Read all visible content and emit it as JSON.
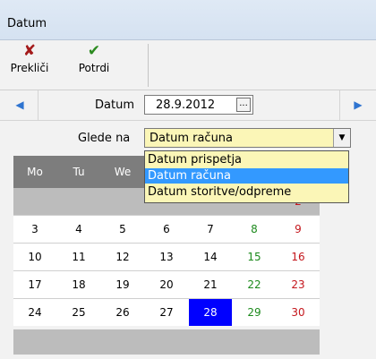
{
  "window": {
    "title": "Datum"
  },
  "toolbar": {
    "cancel_label": "Prekliči",
    "confirm_label": "Potrdi"
  },
  "date_row": {
    "label": "Datum",
    "value": "28.9.2012",
    "ellipsis": "..."
  },
  "glede": {
    "label": "Glede na",
    "selected": "Datum računa",
    "options": [
      "Datum prispetja",
      "Datum računa",
      "Datum storitve/odpreme"
    ],
    "highlighted_option": "Datum računa"
  },
  "calendar": {
    "days_of_week": [
      "Mo",
      "Tu",
      "We",
      "Th",
      "Fr",
      "Sa",
      "Su"
    ],
    "weeks": [
      [
        null,
        null,
        null,
        null,
        null,
        null,
        "2"
      ],
      [
        "3",
        "4",
        "5",
        "6",
        "7",
        "8",
        "9"
      ],
      [
        "10",
        "11",
        "12",
        "13",
        "14",
        "15",
        "16"
      ],
      [
        "17",
        "18",
        "19",
        "20",
        "21",
        "22",
        "23"
      ],
      [
        "24",
        "25",
        "26",
        "27",
        "28",
        "29",
        "30"
      ]
    ],
    "selected_day": "28"
  },
  "colors": {
    "selected_bg": "#0000ff",
    "saturday": "#1d8a1d",
    "sunday": "#c4161c",
    "header_bg": "#7d7d7d",
    "combo_bg": "#fbf6b7",
    "highlight": "#3399ff"
  },
  "icons": {
    "prev": "left-triangle",
    "next": "right-triangle",
    "cancel": "red-x-icon",
    "confirm": "green-check-icon",
    "dropdown": "chevron-down-icon"
  }
}
